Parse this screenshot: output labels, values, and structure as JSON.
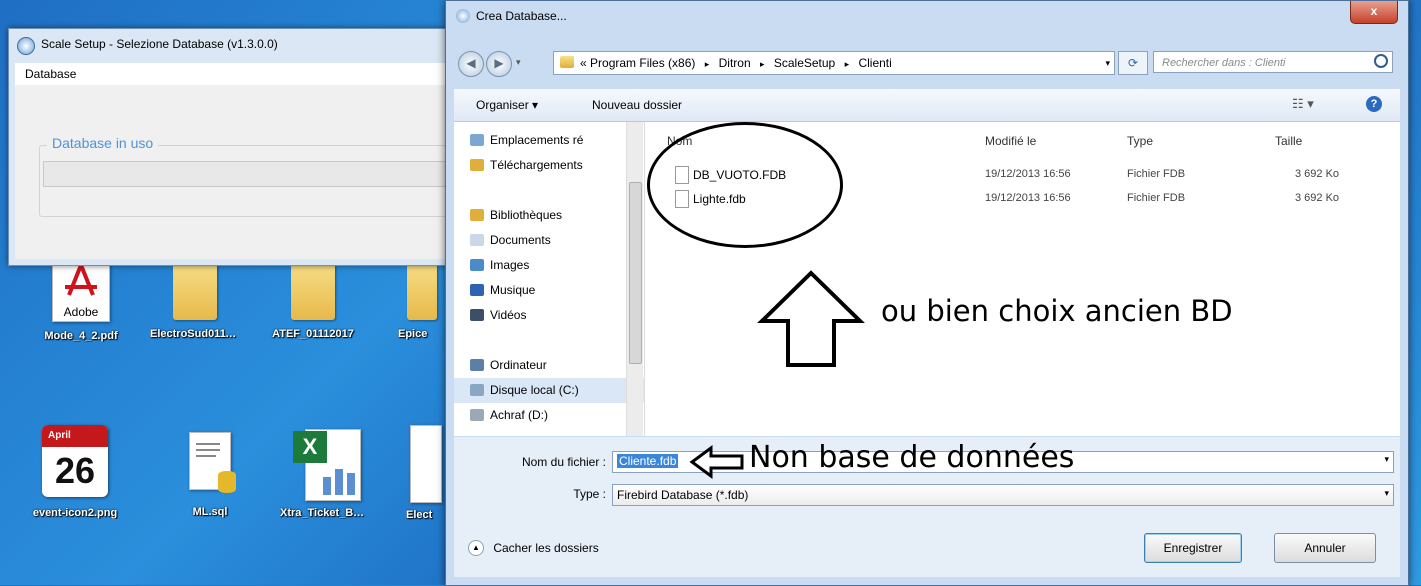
{
  "desktop": {
    "row1": [
      {
        "label": "Mode_4_2.pdf",
        "icon": "pdf-icon",
        "badge": "Adobe"
      },
      {
        "label": "ElectroSud01112...",
        "icon": "folder-icon"
      },
      {
        "label": "ATEF_01112017",
        "icon": "folder-icon"
      },
      {
        "label": "Epice",
        "icon": "folder-icon"
      }
    ],
    "row2": [
      {
        "label": "event-icon2.png",
        "icon": "calendar-icon",
        "month": "April",
        "day": "26"
      },
      {
        "label": "ML.sql",
        "icon": "sql-file-icon"
      },
      {
        "label": "Xtra_Ticket_BL.xls",
        "icon": "excel-icon"
      },
      {
        "label": "Elect",
        "icon": "file-icon"
      }
    ]
  },
  "scale_window": {
    "title": "Scale Setup - Selezione Database (v1.3.0.0)",
    "menu": "Database",
    "group_label": "Database in uso"
  },
  "dialog": {
    "title": "Crea Database...",
    "close": "x",
    "path": [
      "«",
      "Program Files (x86)",
      "Ditron",
      "ScaleSetup",
      "Clienti"
    ],
    "search_placeholder": "Rechercher dans : Clienti",
    "toolbar": {
      "organize": "Organiser ▾",
      "new_folder": "Nouveau dossier"
    },
    "nav": [
      {
        "label": "Emplacements ré",
        "icon": "recent-places-icon"
      },
      {
        "label": "Téléchargements",
        "icon": "downloads-icon"
      },
      {
        "label": "",
        "icon": ""
      },
      {
        "label": "Bibliothèques",
        "icon": "libraries-icon"
      },
      {
        "label": "Documents",
        "icon": "documents-icon"
      },
      {
        "label": "Images",
        "icon": "images-icon"
      },
      {
        "label": "Musique",
        "icon": "music-icon"
      },
      {
        "label": "Vidéos",
        "icon": "videos-icon"
      },
      {
        "label": "",
        "icon": ""
      },
      {
        "label": "Ordinateur",
        "icon": "computer-icon"
      },
      {
        "label": "Disque local (C:)",
        "icon": "local-disk-icon"
      },
      {
        "label": "Achraf (D:)",
        "icon": "drive-icon"
      }
    ],
    "columns": {
      "name": "Nom",
      "modified": "Modifié le",
      "type": "Type",
      "size": "Taille"
    },
    "files": [
      {
        "name": "DB_VUOTO.FDB",
        "modified": "19/12/2013 16:56",
        "type": "Fichier FDB",
        "size": "3 692 Ko"
      },
      {
        "name": "Lighte.fdb",
        "modified": "19/12/2013 16:56",
        "type": "Fichier FDB",
        "size": "3 692 Ko"
      }
    ],
    "filename_label": "Nom du fichier :",
    "filename_value": "Cliente.fdb",
    "type_label": "Type :",
    "type_value": "Firebird Database (*.fdb)",
    "hide_folders": "Cacher les dossiers",
    "save_button": "Enregistrer",
    "cancel_button": "Annuler"
  },
  "annotations": {
    "old_db": "ou bien choix ancien BD",
    "new_db": "Non base de données"
  }
}
